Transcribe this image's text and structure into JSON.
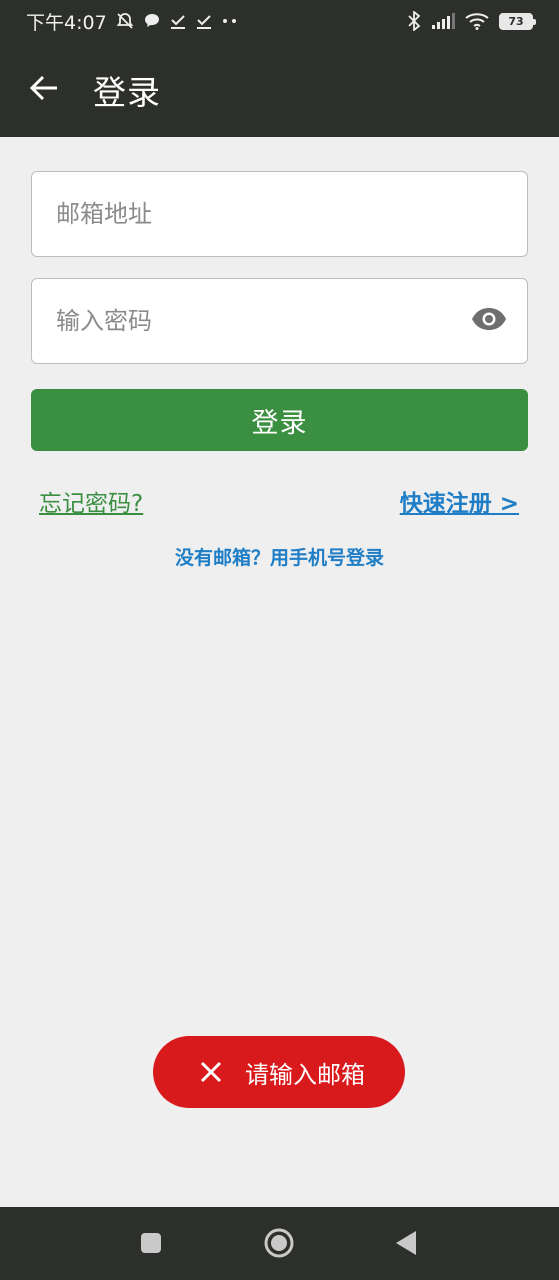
{
  "status_bar": {
    "time": "下午4:07",
    "battery": "73",
    "icons": [
      "mute-bell-icon",
      "chat-bubble-icon",
      "download-done-icon",
      "download-done-icon",
      "more-dots-icon",
      "bluetooth-icon",
      "signal-icon",
      "wifi-icon",
      "battery-icon"
    ]
  },
  "header": {
    "title": "登录",
    "back_icon": "arrow-left-icon"
  },
  "form": {
    "email_placeholder": "邮箱地址",
    "email_value": "",
    "password_placeholder": "输入密码",
    "password_value": "",
    "visibility_icon": "eye-icon",
    "login_button": "登录"
  },
  "links": {
    "forgot_password": "忘记密码?",
    "quick_register": "快速注册 >",
    "phone_login": "没有邮箱？用手机号登录"
  },
  "toast": {
    "message": "请输入邮箱",
    "icon": "close-icon"
  },
  "colors": {
    "primary_green": "#3a8f40",
    "link_blue": "#1f7ec5",
    "toast_red": "#d91a1c",
    "bar_dark": "#2c2f2a",
    "background": "#efeff0"
  },
  "nav_bar": {
    "icons": [
      "recent-apps-icon",
      "home-icon",
      "back-triangle-icon"
    ]
  }
}
